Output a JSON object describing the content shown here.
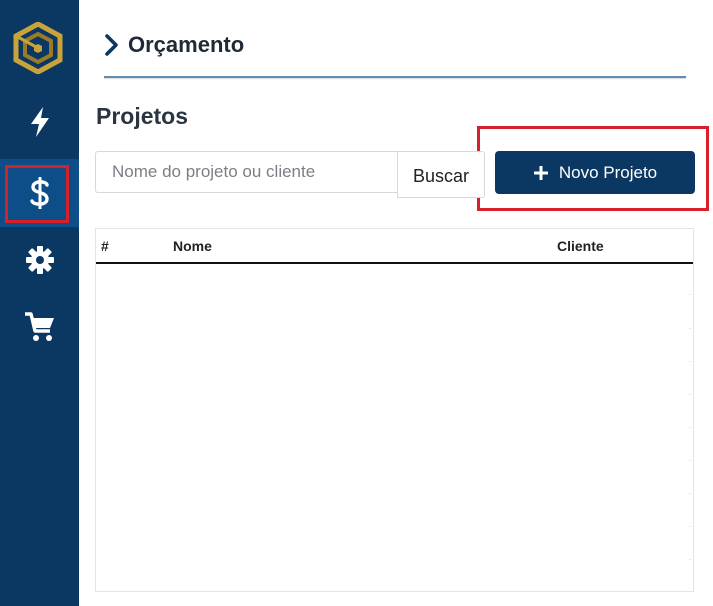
{
  "sidebar": {
    "logo": "gold-shield-logo",
    "items": [
      {
        "icon": "lightning-icon",
        "name": "sidebar-item-activity",
        "active": false
      },
      {
        "icon": "dollar-icon",
        "name": "sidebar-item-budget",
        "active": true
      },
      {
        "icon": "gear-icon",
        "name": "sidebar-item-settings",
        "active": false
      },
      {
        "icon": "cart-icon",
        "name": "sidebar-item-cart",
        "active": false
      }
    ]
  },
  "header": {
    "title": "Orçamento"
  },
  "main": {
    "section_title": "Projetos",
    "search": {
      "placeholder": "Nome do projeto ou cliente",
      "value": "",
      "button_label": "Buscar"
    },
    "new_project_button": {
      "icon": "plus-icon",
      "label": "Novo Projeto"
    },
    "table": {
      "columns": [
        "#",
        "Nome",
        "Cliente"
      ],
      "rows": []
    }
  },
  "colors": {
    "sidebar_bg": "#0b3763",
    "sidebar_active": "#0e4e88",
    "primary_button": "#0b3763",
    "highlight": "#d8202a",
    "logo_gold": "#c9a43a"
  }
}
